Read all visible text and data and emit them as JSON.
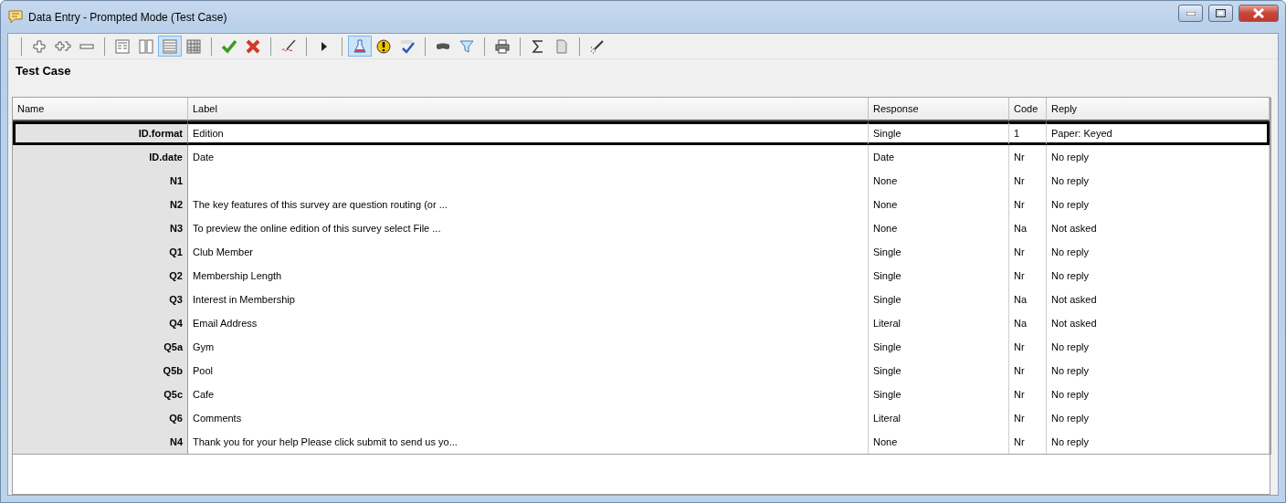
{
  "window": {
    "title": "Data Entry - Prompted Mode (Test Case)"
  },
  "toolbar": [
    [
      {
        "kind": "add"
      },
      {
        "kind": "add-many"
      },
      {
        "kind": "remove"
      }
    ],
    [
      {
        "kind": "form",
        "selected": false
      },
      {
        "kind": "split",
        "selected": false
      },
      {
        "kind": "list",
        "selected": true
      },
      {
        "kind": "grid",
        "selected": false
      }
    ],
    [
      {
        "kind": "accept"
      },
      {
        "kind": "reject"
      }
    ],
    [
      {
        "kind": "sign"
      }
    ],
    [
      {
        "kind": "play"
      }
    ],
    [
      {
        "kind": "flask",
        "selected": true
      },
      {
        "kind": "warning",
        "selected": false
      },
      {
        "kind": "spell"
      }
    ],
    [
      {
        "kind": "mask"
      },
      {
        "kind": "filter"
      }
    ],
    [
      {
        "kind": "print"
      }
    ],
    [
      {
        "kind": "sum"
      },
      {
        "kind": "document"
      }
    ],
    [
      {
        "kind": "wand"
      }
    ]
  ],
  "heading": "Test Case",
  "table": {
    "columns": [
      "Name",
      "Label",
      "Response",
      "Code",
      "Reply"
    ],
    "rows": [
      {
        "cells": [
          "ID.format",
          "Edition",
          "Single",
          "1",
          "Paper: Keyed"
        ],
        "selected": true
      },
      {
        "cells": [
          "ID.date",
          "Date",
          "Date",
          "Nr",
          "No reply"
        ],
        "selected": false
      },
      {
        "cells": [
          "N1",
          "",
          "None",
          "Nr",
          "No reply"
        ],
        "selected": false
      },
      {
        "cells": [
          "N2",
          "The key features of this survey are question routing (or ...",
          "None",
          "Nr",
          "No reply"
        ],
        "selected": false
      },
      {
        "cells": [
          "N3",
          "To preview the online edition of this survey select File ...",
          "None",
          "Na",
          "Not asked"
        ],
        "selected": false
      },
      {
        "cells": [
          "Q1",
          "Club Member",
          "Single",
          "Nr",
          "No reply"
        ],
        "selected": false
      },
      {
        "cells": [
          "Q2",
          "Membership Length",
          "Single",
          "Nr",
          "No reply"
        ],
        "selected": false
      },
      {
        "cells": [
          "Q3",
          "Interest in Membership",
          "Single",
          "Na",
          "Not asked"
        ],
        "selected": false
      },
      {
        "cells": [
          "Q4",
          "Email Address",
          "Literal",
          "Na",
          "Not asked"
        ],
        "selected": false
      },
      {
        "cells": [
          "Q5a",
          "Gym",
          "Single",
          "Nr",
          "No reply"
        ],
        "selected": false
      },
      {
        "cells": [
          "Q5b",
          "Pool",
          "Single",
          "Nr",
          "No reply"
        ],
        "selected": false
      },
      {
        "cells": [
          "Q5c",
          "Cafe",
          "Single",
          "Nr",
          "No reply"
        ],
        "selected": false
      },
      {
        "cells": [
          "Q6",
          "Comments",
          "Literal",
          "Nr",
          "No reply"
        ],
        "selected": false
      },
      {
        "cells": [
          "N4",
          "Thank you for your help Please click submit to send us yo...",
          "None",
          "Nr",
          "No reply"
        ],
        "selected": false
      }
    ]
  }
}
